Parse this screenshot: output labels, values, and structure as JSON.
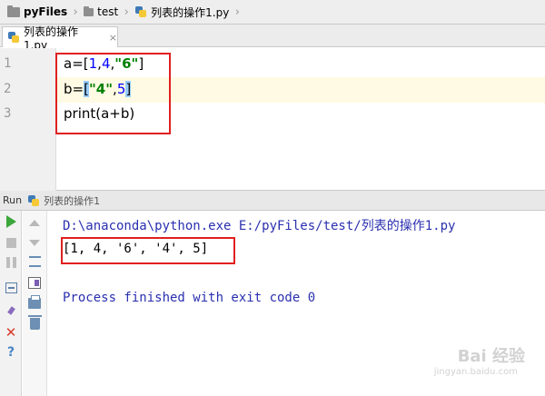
{
  "breadcrumb": {
    "items": [
      {
        "label": "pyFiles",
        "icon": "folder-icon"
      },
      {
        "label": "test",
        "icon": "folder-icon"
      },
      {
        "label": "列表的操作1.py",
        "icon": "python-file-icon"
      }
    ]
  },
  "editor_tab": {
    "label": "列表的操作1.py",
    "close": "×"
  },
  "editor": {
    "line_numbers": [
      "1",
      "2",
      "3"
    ],
    "lines": [
      {
        "segments": [
          {
            "text": "a=[",
            "cls": ""
          },
          {
            "text": "1",
            "cls": "num"
          },
          {
            "text": ",",
            "cls": ""
          },
          {
            "text": "4",
            "cls": "num"
          },
          {
            "text": ",",
            "cls": ""
          },
          {
            "text": "\"6\"",
            "cls": "str"
          },
          {
            "text": "]",
            "cls": ""
          }
        ]
      },
      {
        "segments": [
          {
            "text": "b=",
            "cls": ""
          },
          {
            "text": "[",
            "cls": "brk-hl"
          },
          {
            "text": "\"4\"",
            "cls": "str"
          },
          {
            "text": ",",
            "cls": ""
          },
          {
            "text": "5",
            "cls": "num"
          },
          {
            "text": "]",
            "cls": "brk-hl"
          }
        ]
      },
      {
        "segments": [
          {
            "text": "print(a+b)",
            "cls": ""
          }
        ]
      }
    ]
  },
  "run": {
    "title": "Run",
    "config": "列表的操作1",
    "console": {
      "command": "D:\\anaconda\\python.exe E:/pyFiles/test/列表的操作1.py",
      "output": "[1, 4, '6', '4', 5]",
      "finished": "Process finished with exit code 0"
    }
  },
  "watermark": {
    "text": "Bai 经验",
    "url": "jingyan.baidu.com"
  },
  "colors": {
    "highlight_box": "#e02020",
    "run_green": "#3ba63b",
    "console_blue": "#2a30b0"
  }
}
